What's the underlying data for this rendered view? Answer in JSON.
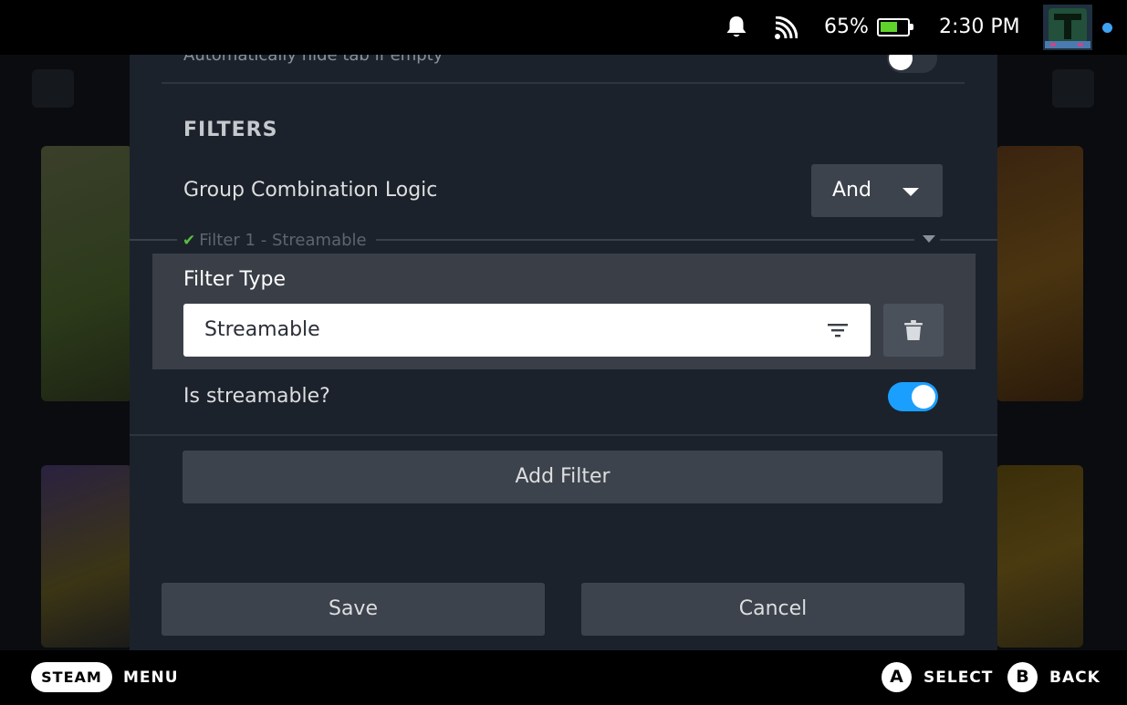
{
  "status": {
    "battery_percent": "65%",
    "battery_level": 0.65,
    "time": "2:30 PM"
  },
  "dialog": {
    "auto_hide_label": "Automatically hide tab if empty",
    "auto_hide_on": false,
    "filters_title": "FILTERS",
    "combination_label": "Group Combination Logic",
    "combination_value": "And",
    "filter_group_label": "Filter 1 - Streamable",
    "filter_type_label": "Filter Type",
    "filter_type_value": "Streamable",
    "streamable_label": "Is streamable?",
    "streamable_on": true,
    "add_filter_label": "Add Filter",
    "save_label": "Save",
    "cancel_label": "Cancel"
  },
  "bottom_bar": {
    "steam_label": "STEAM",
    "menu_label": "MENU",
    "a_glyph": "A",
    "select_label": "SELECT",
    "b_glyph": "B",
    "back_label": "BACK"
  },
  "colors": {
    "accent": "#1a9fff",
    "dialog_bg": "#1c222b",
    "button_bg": "#3d434d",
    "battery_green": "#5fd32c",
    "check_green": "#59bf40"
  }
}
